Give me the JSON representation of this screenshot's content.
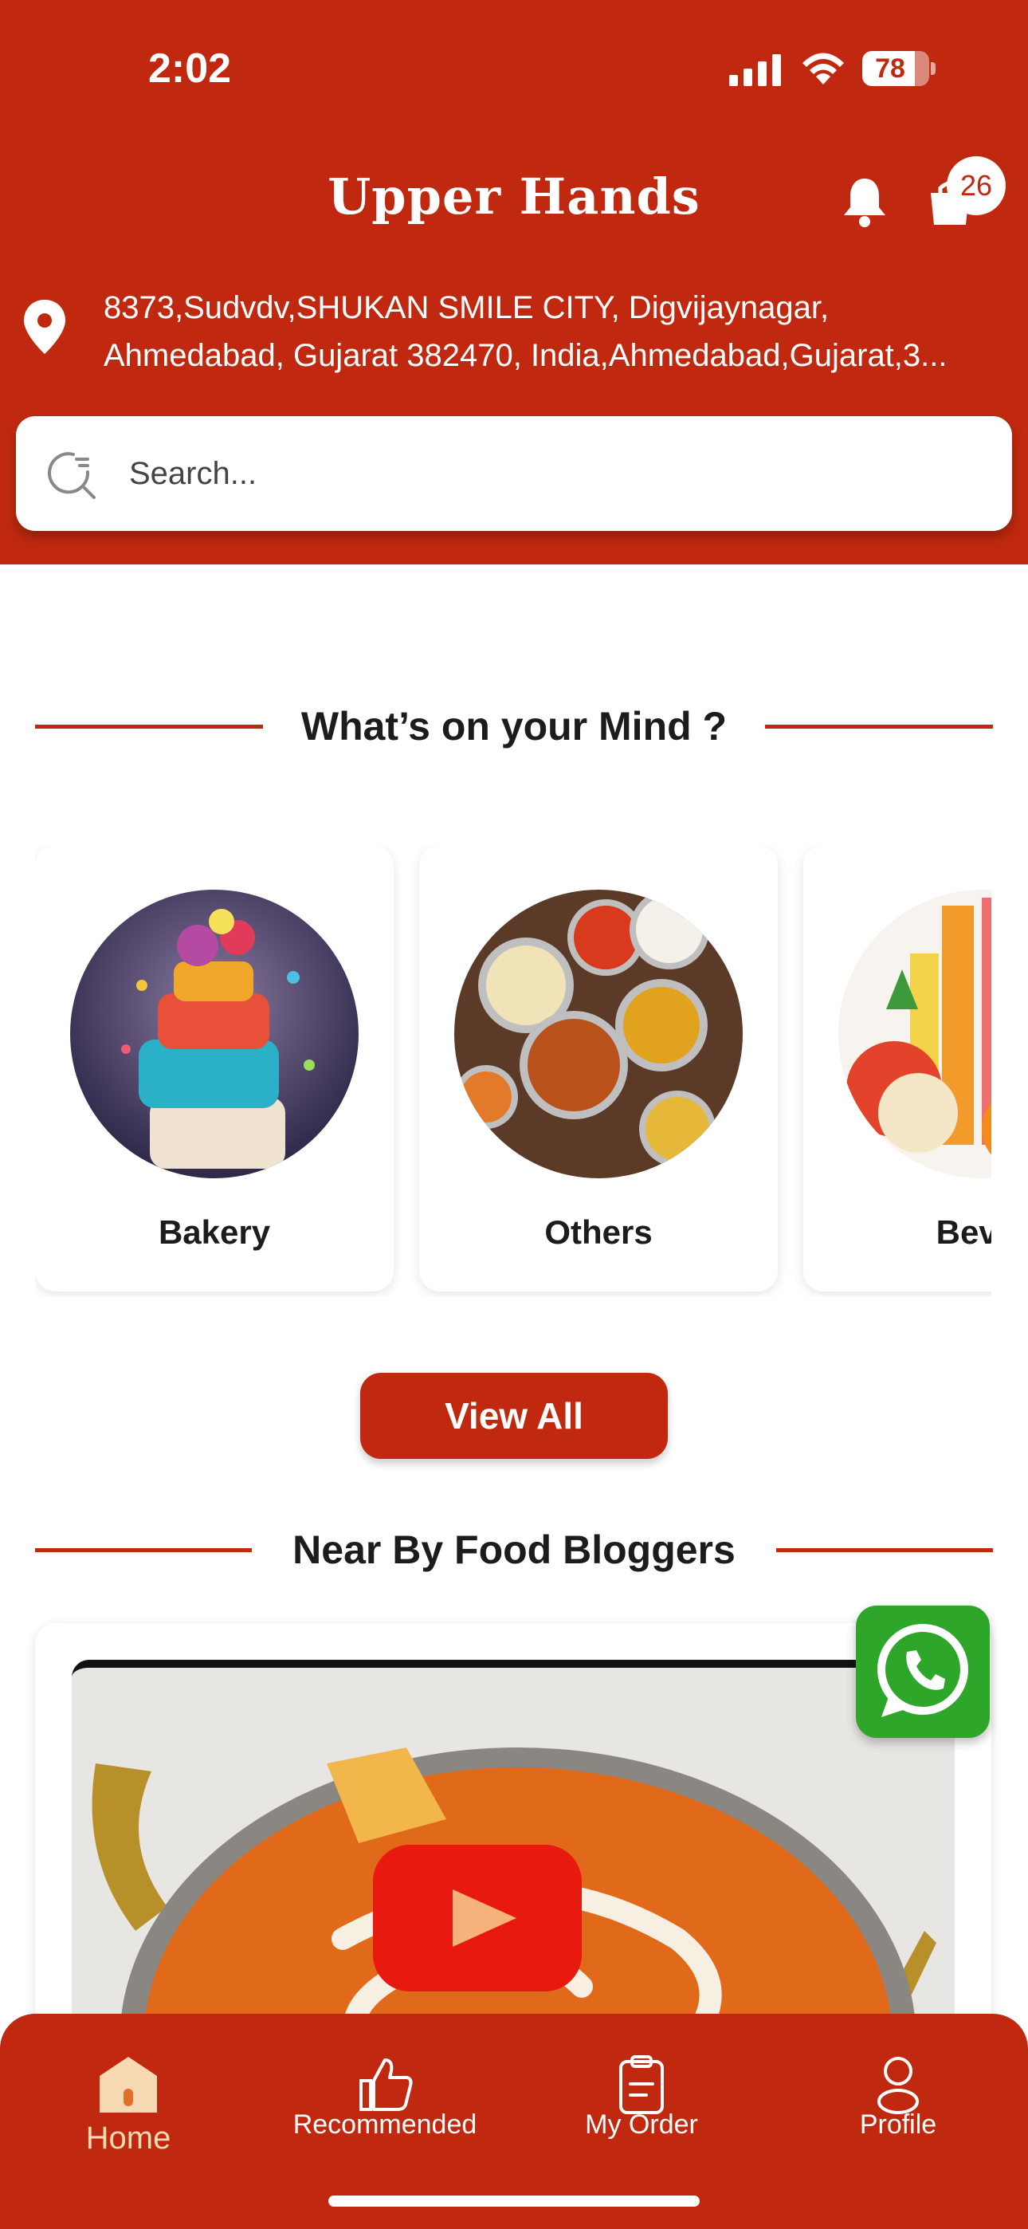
{
  "status_bar": {
    "time": "2:02",
    "battery": "78",
    "battery_level": 0.78
  },
  "header": {
    "title": "Upper Hands",
    "cart_count": "26",
    "address_line1": "8373,Sudvdv,SHUKAN SMILE CITY, Digvijaynagar,",
    "address_line2": "Ahmedabad, Gujarat 382470, India,Ahmedabad,Gujarat,3...",
    "search_placeholder": "Search..."
  },
  "sections": {
    "categories_title": "What’s on your Mind ?",
    "bloggers_title": "Near By Food Bloggers"
  },
  "categories": [
    {
      "label": "Bakery"
    },
    {
      "label": "Others"
    },
    {
      "label": "Bever"
    }
  ],
  "view_all_label": "View All",
  "bottom_nav": {
    "items": [
      {
        "label": "Home",
        "icon": "home-icon"
      },
      {
        "label": "Recommended",
        "icon": "thumbs-up-icon"
      },
      {
        "label": "My Order",
        "icon": "clipboard-icon"
      },
      {
        "label": "Profile",
        "icon": "user-icon"
      }
    ],
    "active": "Home"
  },
  "colors": {
    "brand": "#c0290f",
    "whatsapp": "#2ea62a",
    "youtube": "#e8190f",
    "active_nav": "#f7d9b4"
  }
}
